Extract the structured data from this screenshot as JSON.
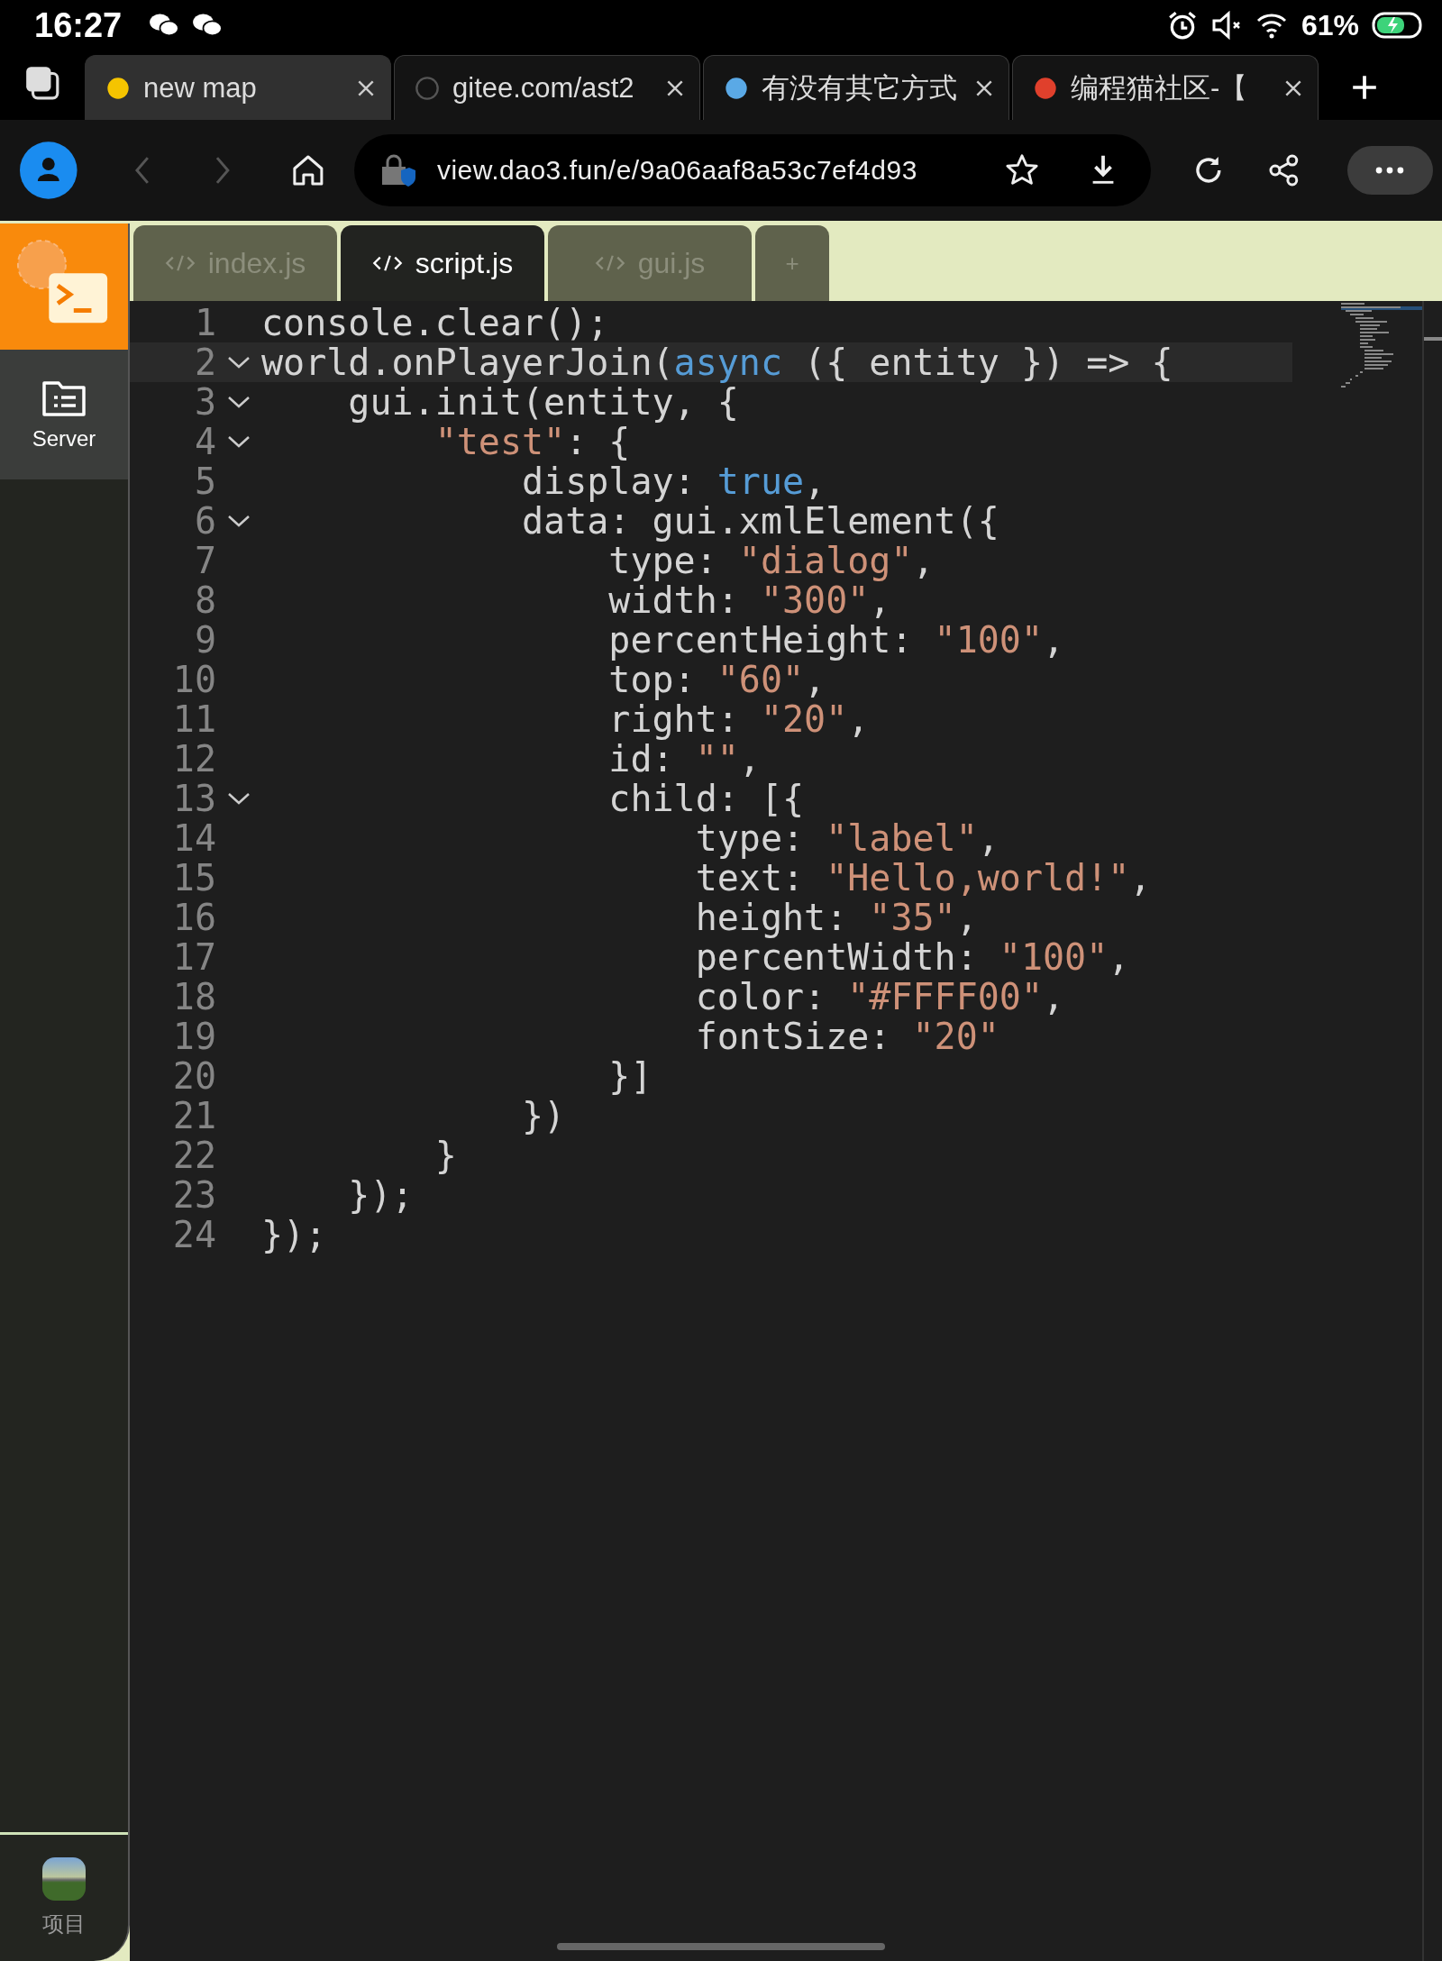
{
  "status_bar": {
    "time": "16:27",
    "battery": "61%"
  },
  "browser_tabs": [
    {
      "title": "new map",
      "selected": true
    },
    {
      "title": "gitee.com/ast2",
      "selected": false
    },
    {
      "title": "有没有其它方式",
      "selected": false
    },
    {
      "title": "编程猫社区-【",
      "selected": false
    }
  ],
  "address_bar": {
    "url": "view.dao3.fun/e/9a06aaf8a53c7ef4d93"
  },
  "sidebar": {
    "items": [
      {
        "label": "Server",
        "selected": true
      }
    ],
    "bottom_item": {
      "label": "项目"
    }
  },
  "editor_tabs": [
    {
      "label": "index.js",
      "selected": false
    },
    {
      "label": "script.js",
      "selected": true
    },
    {
      "label": "gui.js",
      "selected": false
    }
  ],
  "add_tab": "+",
  "code_lines": [
    {
      "number": "1",
      "foldable": false,
      "current": false,
      "tokens": [
        {
          "kind": "plain",
          "text": "console.clear();"
        }
      ]
    },
    {
      "number": "2",
      "foldable": true,
      "current": true,
      "tokens": [
        {
          "kind": "plain",
          "text": "world.onPlayerJoin("
        },
        {
          "kind": "keyword",
          "text": "async"
        },
        {
          "kind": "plain",
          "text": " ({ entity }) => {"
        }
      ]
    },
    {
      "number": "3",
      "foldable": true,
      "current": false,
      "tokens": [
        {
          "kind": "plain",
          "text": "    gui.init(entity, {"
        }
      ]
    },
    {
      "number": "4",
      "foldable": true,
      "current": false,
      "tokens": [
        {
          "kind": "string",
          "text": "        \"test\""
        },
        {
          "kind": "plain",
          "text": ": {"
        }
      ]
    },
    {
      "number": "5",
      "foldable": false,
      "current": false,
      "tokens": [
        {
          "kind": "plain",
          "text": "            display: "
        },
        {
          "kind": "keyword",
          "text": "true"
        },
        {
          "kind": "plain",
          "text": ","
        }
      ]
    },
    {
      "number": "6",
      "foldable": true,
      "current": false,
      "tokens": [
        {
          "kind": "plain",
          "text": "            data: gui.xmlElement({"
        }
      ]
    },
    {
      "number": "7",
      "foldable": false,
      "current": false,
      "tokens": [
        {
          "kind": "plain",
          "text": "                type: "
        },
        {
          "kind": "string",
          "text": "\"dialog\""
        },
        {
          "kind": "plain",
          "text": ","
        }
      ]
    },
    {
      "number": "8",
      "foldable": false,
      "current": false,
      "tokens": [
        {
          "kind": "plain",
          "text": "                width: "
        },
        {
          "kind": "string",
          "text": "\"300\""
        },
        {
          "kind": "plain",
          "text": ","
        }
      ]
    },
    {
      "number": "9",
      "foldable": false,
      "current": false,
      "tokens": [
        {
          "kind": "plain",
          "text": "                percentHeight: "
        },
        {
          "kind": "string",
          "text": "\"100\""
        },
        {
          "kind": "plain",
          "text": ","
        }
      ]
    },
    {
      "number": "10",
      "foldable": false,
      "current": false,
      "tokens": [
        {
          "kind": "plain",
          "text": "                top: "
        },
        {
          "kind": "string",
          "text": "\"60\""
        },
        {
          "kind": "plain",
          "text": ","
        }
      ]
    },
    {
      "number": "11",
      "foldable": false,
      "current": false,
      "tokens": [
        {
          "kind": "plain",
          "text": "                right: "
        },
        {
          "kind": "string",
          "text": "\"20\""
        },
        {
          "kind": "plain",
          "text": ","
        }
      ]
    },
    {
      "number": "12",
      "foldable": false,
      "current": false,
      "tokens": [
        {
          "kind": "plain",
          "text": "                id: "
        },
        {
          "kind": "string",
          "text": "\"\""
        },
        {
          "kind": "plain",
          "text": ","
        }
      ]
    },
    {
      "number": "13",
      "foldable": true,
      "current": false,
      "tokens": [
        {
          "kind": "plain",
          "text": "                child: [{"
        }
      ]
    },
    {
      "number": "14",
      "foldable": false,
      "current": false,
      "tokens": [
        {
          "kind": "plain",
          "text": "                    type: "
        },
        {
          "kind": "string",
          "text": "\"label\""
        },
        {
          "kind": "plain",
          "text": ","
        }
      ]
    },
    {
      "number": "15",
      "foldable": false,
      "current": false,
      "tokens": [
        {
          "kind": "plain",
          "text": "                    text: "
        },
        {
          "kind": "string",
          "text": "\"Hello,world!\""
        },
        {
          "kind": "plain",
          "text": ","
        }
      ]
    },
    {
      "number": "16",
      "foldable": false,
      "current": false,
      "tokens": [
        {
          "kind": "plain",
          "text": "                    height: "
        },
        {
          "kind": "string",
          "text": "\"35\""
        },
        {
          "kind": "plain",
          "text": ","
        }
      ]
    },
    {
      "number": "17",
      "foldable": false,
      "current": false,
      "tokens": [
        {
          "kind": "plain",
          "text": "                    percentWidth: "
        },
        {
          "kind": "string",
          "text": "\"100\""
        },
        {
          "kind": "plain",
          "text": ","
        }
      ]
    },
    {
      "number": "18",
      "foldable": false,
      "current": false,
      "tokens": [
        {
          "kind": "plain",
          "text": "                    color: "
        },
        {
          "kind": "string",
          "text": "\"#FFFF00\""
        },
        {
          "kind": "plain",
          "text": ","
        }
      ]
    },
    {
      "number": "19",
      "foldable": false,
      "current": false,
      "tokens": [
        {
          "kind": "plain",
          "text": "                    fontSize: "
        },
        {
          "kind": "string",
          "text": "\"20\""
        }
      ]
    },
    {
      "number": "20",
      "foldable": false,
      "current": false,
      "tokens": [
        {
          "kind": "plain",
          "text": "                }]"
        }
      ]
    },
    {
      "number": "21",
      "foldable": false,
      "current": false,
      "tokens": [
        {
          "kind": "plain",
          "text": "            })"
        }
      ]
    },
    {
      "number": "22",
      "foldable": false,
      "current": false,
      "tokens": [
        {
          "kind": "plain",
          "text": "        }"
        }
      ]
    },
    {
      "number": "23",
      "foldable": false,
      "current": false,
      "tokens": [
        {
          "kind": "plain",
          "text": "    });"
        }
      ]
    },
    {
      "number": "24",
      "foldable": false,
      "current": false,
      "tokens": [
        {
          "kind": "plain",
          "text": "});"
        }
      ]
    }
  ]
}
